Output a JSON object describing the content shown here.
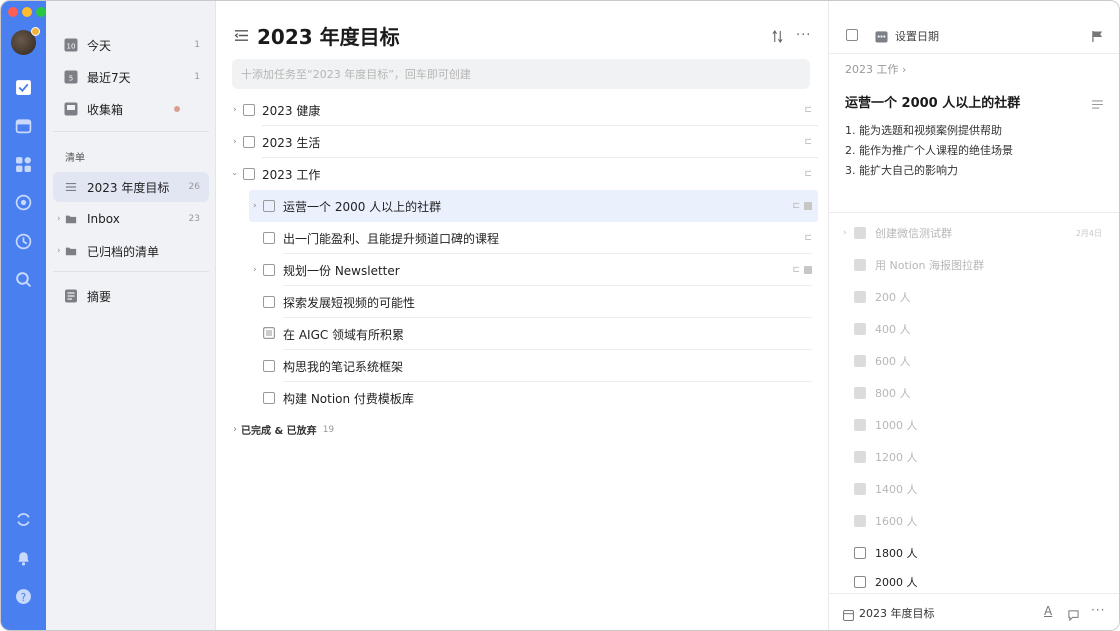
{
  "rail": {
    "traffic_lights": [
      "#fe5f57",
      "#febc2e",
      "#28c840"
    ],
    "accent": "#4a7ff0"
  },
  "sidebar": {
    "smart_lists": [
      {
        "label": "今天",
        "count": "1",
        "icon_text": "10"
      },
      {
        "label": "最近7天",
        "count": "1",
        "icon_text": "5"
      },
      {
        "label": "收集箱",
        "count": "",
        "icon_text": ""
      }
    ],
    "section_label": "清单",
    "lists": [
      {
        "label": "2023 年度目标",
        "count": "26"
      },
      {
        "label": "Inbox",
        "count": "23"
      },
      {
        "label": "已归档的清单",
        "count": ""
      }
    ],
    "summary_label": "摘要"
  },
  "main": {
    "title": "2023 年度目标",
    "add_placeholder": "十添加任务至“2023 年度目标”，回车即可创建",
    "tasks": [
      {
        "label": "2023 健康"
      },
      {
        "label": "2023 生活"
      },
      {
        "label": "2023 工作"
      },
      {
        "label": "运营一个 2000 人以上的社群"
      },
      {
        "label": "出一门能盈利、且能提升频道口碑的课程"
      },
      {
        "label": "规划一份 Newsletter"
      },
      {
        "label": "探索发展短视频的可能性"
      },
      {
        "label": "在 AIGC 领域有所积累"
      },
      {
        "label": "构思我的笔记系统框架"
      },
      {
        "label": "构建 Notion 付费模板库"
      }
    ],
    "completed_label": "已完成 & 已放弃",
    "completed_count": "19"
  },
  "detail": {
    "set_date_label": "设置日期",
    "breadcrumb": "2023 工作 ›",
    "title": "运营一个 2000 人以上的社群",
    "description": [
      "1. 能为选题和视频案例提供帮助",
      "2. 能作为推广个人课程的绝佳场景",
      "3. 能扩大自己的影响力"
    ],
    "first_subtask": "创建微信测试群",
    "first_subtask_date": "2月4日",
    "subtasks": [
      {
        "label": "用 Notion 海报图拉群",
        "done": true
      },
      {
        "label": "200 人",
        "done": true
      },
      {
        "label": "400 人",
        "done": true
      },
      {
        "label": "600 人",
        "done": true
      },
      {
        "label": "800 人",
        "done": true
      },
      {
        "label": "1000 人",
        "done": true
      },
      {
        "label": "1200 人",
        "done": true
      },
      {
        "label": "1400 人",
        "done": true
      },
      {
        "label": "1600 人",
        "done": true
      },
      {
        "label": "1800 人",
        "done": false
      },
      {
        "label": "2000 人",
        "done": false
      }
    ],
    "footer_list": "2023 年度目标"
  }
}
